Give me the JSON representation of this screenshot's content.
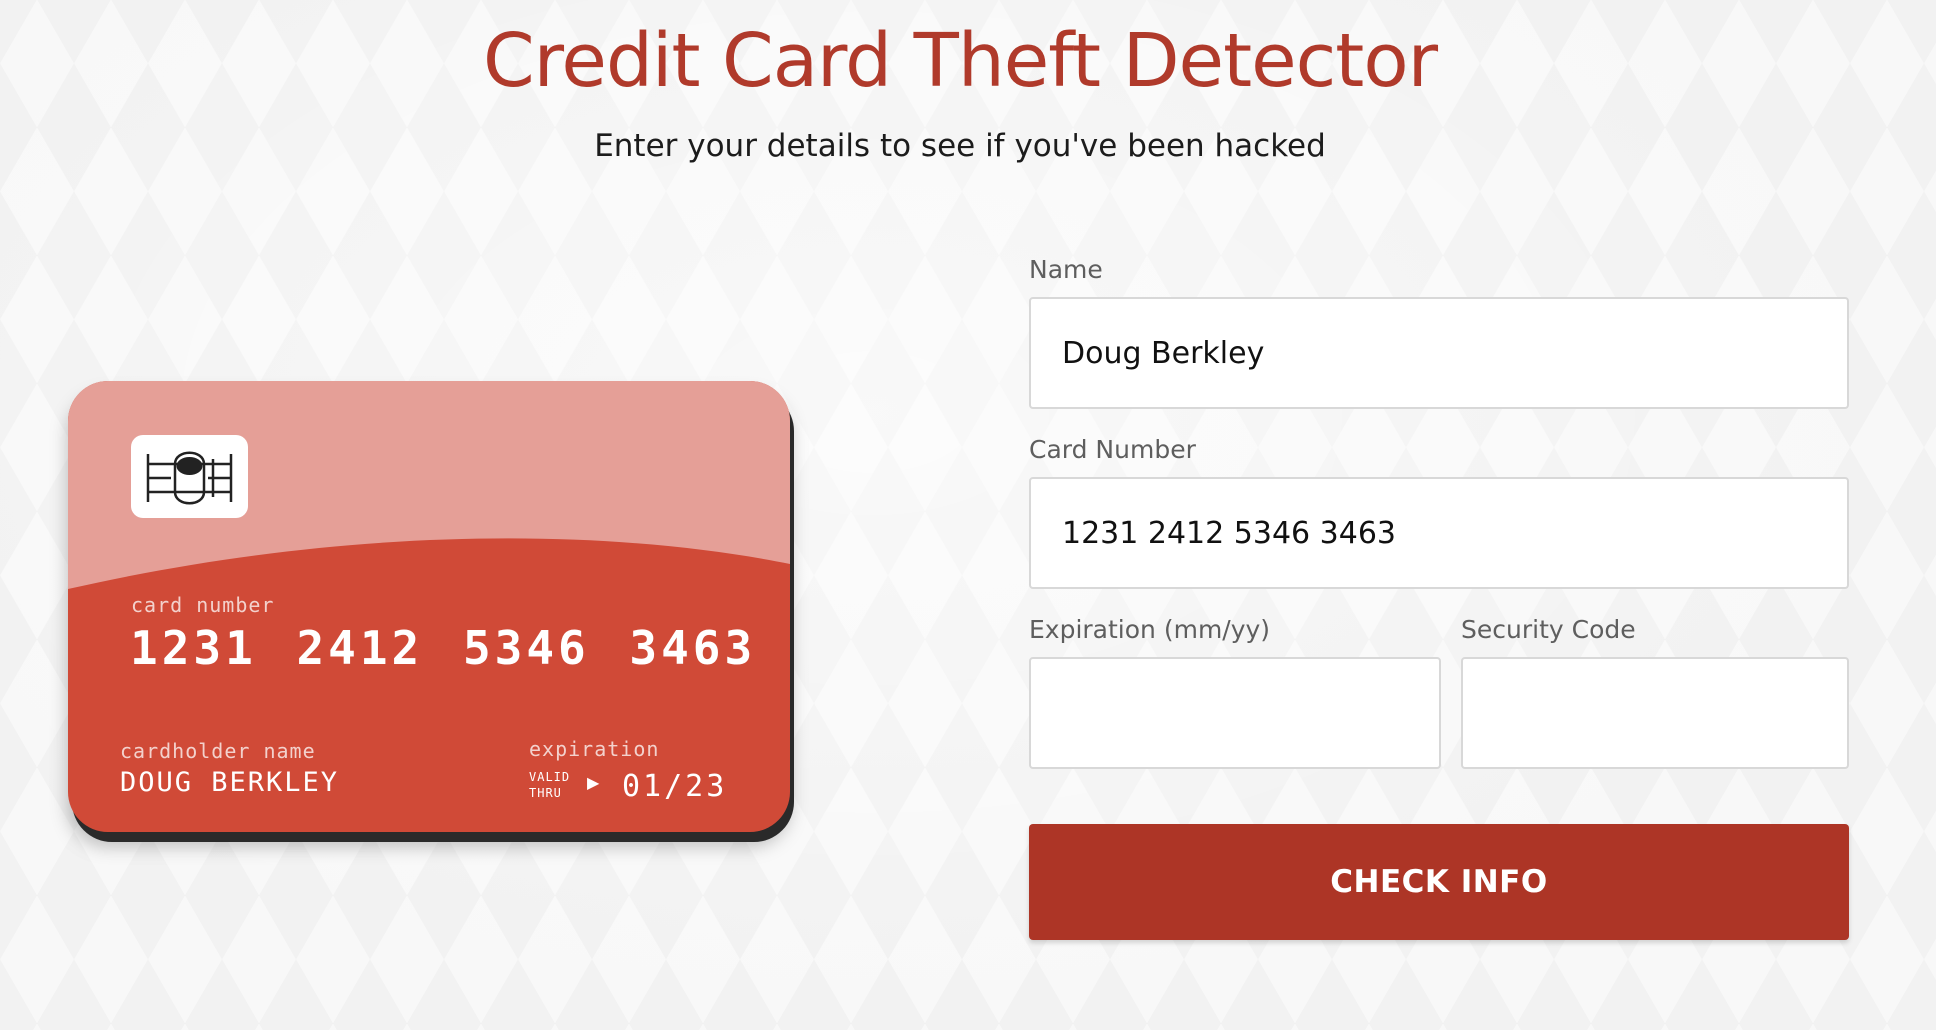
{
  "header": {
    "title": "Credit Card Theft Detector",
    "subtitle": "Enter your details to see if you've been hacked"
  },
  "card": {
    "number_label": "card number",
    "number": "1231 2412 5346 3463",
    "holder_label": "cardholder name",
    "holder": "DOUG BERKLEY",
    "expiration_label": "expiration",
    "valid_thru_line1": "VALID",
    "valid_thru_line2": "THRU",
    "valid_thru_arrow": "▶",
    "expiration": "01/23",
    "chip_icon": "sim-chip-icon",
    "colors": {
      "card_light": "#e59f97",
      "card_main": "#d04a37"
    }
  },
  "form": {
    "name_label": "Name",
    "name_value": "Doug Berkley",
    "card_number_label": "Card Number",
    "card_number_value": "1231 2412 5346 3463",
    "expiration_label": "Expiration (mm/yy)",
    "expiration_value": "",
    "security_code_label": "Security Code",
    "security_code_value": "",
    "submit_label": "CHECK INFO"
  },
  "colors": {
    "accent": "#b03a2b",
    "button": "#ad3526"
  }
}
